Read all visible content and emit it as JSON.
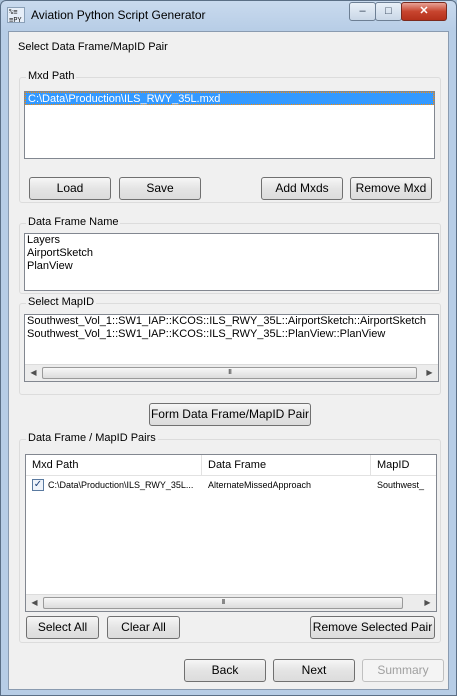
{
  "window": {
    "title": "Aviation Python Script Generator",
    "app_icon_text": "%≡\n≡PY",
    "minimize_glyph": "–",
    "maximize_glyph": "□",
    "close_glyph": "✕"
  },
  "page": {
    "title": "Select Data Frame/MapID Pair"
  },
  "mxd_path": {
    "label": "Mxd Path",
    "items": [
      "C:\\Data\\Production\\ILS_RWY_35L.mxd"
    ],
    "selected_index": 0,
    "buttons": {
      "load": "Load",
      "save": "Save",
      "add": "Add Mxds",
      "remove": "Remove Mxd"
    }
  },
  "data_frame": {
    "label": "Data Frame Name",
    "items": [
      "Layers",
      "AirportSketch",
      "PlanView"
    ]
  },
  "mapid": {
    "label": "Select MapID",
    "items": [
      "Southwest_Vol_1::SW1_IAP::KCOS::ILS_RWY_35L::AirportSketch::AirportSketch",
      "Southwest_Vol_1::SW1_IAP::KCOS::ILS_RWY_35L::PlanView::PlanView"
    ],
    "scroll": {
      "left": "◀",
      "right": "▶",
      "thumb": "III"
    }
  },
  "form_pair_button": "Form Data Frame/MapID Pair",
  "pairs": {
    "label": "Data Frame / MapID Pairs",
    "columns": [
      "Mxd Path",
      "Data Frame",
      "MapID"
    ],
    "rows": [
      {
        "checked": true,
        "check_glyph": "✓",
        "mxd_path": "C:\\Data\\Production\\ILS_RWY_35L...",
        "data_frame": "AlternateMissedApproach",
        "mapid": "Southwest_"
      }
    ],
    "scroll": {
      "left": "◀",
      "right": "▶",
      "thumb": "III"
    },
    "buttons": {
      "select_all": "Select All",
      "clear_all": "Clear All",
      "remove_selected": "Remove Selected Pair"
    }
  },
  "nav": {
    "back": "Back",
    "next": "Next",
    "summary": "Summary"
  }
}
